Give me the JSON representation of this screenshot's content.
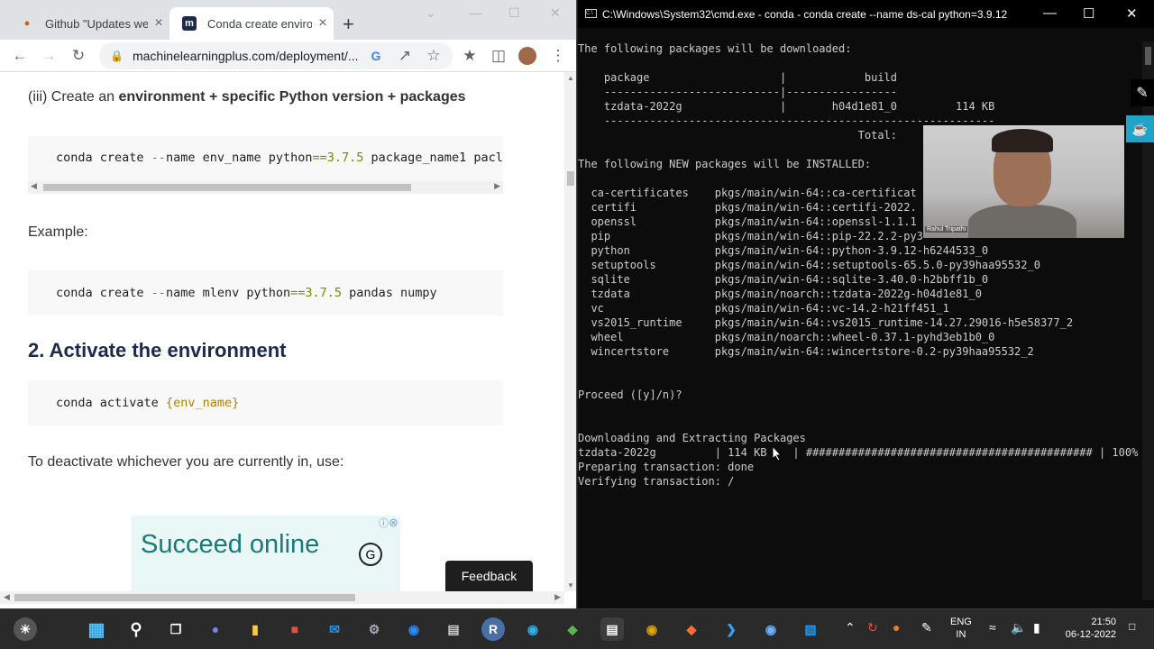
{
  "browser": {
    "tabs": [
      {
        "title": "Github \"Updates were",
        "favicon": "github-icon"
      },
      {
        "title": "Conda create environ",
        "favicon": "m"
      }
    ],
    "url": "machinelearningplus.com/deployment/...",
    "page": {
      "step3_prefix": "(iii) Create an ",
      "step3_bold": "environment + specific Python version + packages",
      "code1": {
        "a": "conda create ",
        "b": "--",
        "c": "name env_name python",
        "d": "==",
        "e": "3.7.5",
        "f": " package_name1 pacl"
      },
      "example_label": "Example:",
      "code2": {
        "a": "conda create ",
        "b": "--",
        "c": "name mlenv python",
        "d": "==",
        "e": "3.7.5",
        "f": " pandas numpy"
      },
      "heading2": "2. Activate the environment",
      "code3": {
        "a": "conda activate ",
        "b": "{",
        "c": "env_name",
        "d": "}"
      },
      "deactivate_text": "To deactivate whichever you are currently in, use:",
      "ad_text": "Succeed online",
      "feedback_label": "Feedback"
    }
  },
  "terminal": {
    "title": "C:\\Windows\\System32\\cmd.exe - conda  - conda  create --name ds-cal python=3.9.12",
    "lines": [
      "The following packages will be downloaded:",
      "",
      "    package                    |            build",
      "    ---------------------------|-----------------",
      "    tzdata-2022g               |       h04d1e81_0         114 KB",
      "    ------------------------------------------------------------",
      "                                           Total:",
      "",
      "The following NEW packages will be INSTALLED:",
      "",
      "  ca-certificates    pkgs/main/win-64::ca-certificat",
      "  certifi            pkgs/main/win-64::certifi-2022.",
      "  openssl            pkgs/main/win-64::openssl-1.1.1",
      "  pip                pkgs/main/win-64::pip-22.2.2-py3",
      "  python             pkgs/main/win-64::python-3.9.12-h6244533_0",
      "  setuptools         pkgs/main/win-64::setuptools-65.5.0-py39haa95532_0",
      "  sqlite             pkgs/main/win-64::sqlite-3.40.0-h2bbff1b_0",
      "  tzdata             pkgs/main/noarch::tzdata-2022g-h04d1e81_0",
      "  vc                 pkgs/main/win-64::vc-14.2-h21ff451_1",
      "  vs2015_runtime     pkgs/main/win-64::vs2015_runtime-14.27.29016-h5e58377_2",
      "  wheel              pkgs/main/noarch::wheel-0.37.1-pyhd3eb1b0_0",
      "  wincertstore       pkgs/main/win-64::wincertstore-0.2-py39haa95532_2",
      "",
      "",
      "Proceed ([y]/n)?",
      "",
      "",
      "Downloading and Extracting Packages",
      "tzdata-2022g         | 114 KB    | ############################################ | 100%",
      "Preparing transaction: done",
      "Verifying transaction: /"
    ],
    "webcam_name": "Rahul Tripathi"
  },
  "taskbar": {
    "lang_top": "ENG",
    "lang_bottom": "IN",
    "time": "21:50",
    "date": "06-12-2022"
  }
}
